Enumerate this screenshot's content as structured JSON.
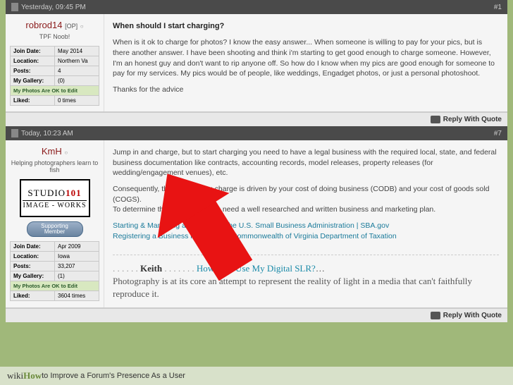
{
  "post1": {
    "timestamp": "Yesterday, 09:45 PM",
    "number": "#1",
    "user": {
      "name": "robrod14",
      "op_tag": "[OP]",
      "status_glyph": "○",
      "title": "TPF Noob!",
      "stats": {
        "join_label": "Join Date:",
        "join_value": "May 2014",
        "loc_label": "Location:",
        "loc_value": "Northern Va",
        "posts_label": "Posts:",
        "posts_value": "4",
        "gallery_label": "My Gallery:",
        "gallery_value": "(0)",
        "edit_ok": "My Photos Are OK to Edit",
        "liked_label": "Liked:",
        "liked_value": "0 times"
      }
    },
    "content": {
      "title": "When should I start charging?",
      "body1": "When is it ok to charge for photos? I know the easy answer... When someone is willing to pay for your pics, but is there another answer. I have been shooting and think i'm starting to get good enough to charge someone. However, I'm an honest guy and don't want to rip anyone off. So how do I know when my pics are good enough for someone to pay for my services. My pics would be of people, like weddings, Engadget photos, or just a personal photoshoot.",
      "body2": "Thanks for the advice"
    },
    "reply_label": "Reply With Quote"
  },
  "post2": {
    "timestamp": "Today, 10:23 AM",
    "number": "#7",
    "user": {
      "name": "KmH",
      "status_glyph": "○",
      "title": "Helping photographers learn to fish",
      "logo_top": "STUDIO",
      "logo_num": "101",
      "logo_bot": "IMAGE - WORKS",
      "support1": "Supporting",
      "support2": "Member",
      "stats": {
        "join_label": "Join Date:",
        "join_value": "Apr 2009",
        "loc_label": "Location:",
        "loc_value": "Iowa",
        "posts_label": "Posts:",
        "posts_value": "33,207",
        "gallery_label": "My Gallery:",
        "gallery_value": "(1)",
        "edit_ok": "My Photos Are OK to Edit",
        "liked_label": "Liked:",
        "liked_value": "3604 times"
      }
    },
    "content": {
      "body1": "Jump in and charge, but to start charging you need to have a legal business with the required local, state, and federal business documentation like contracts, accounting records, model releases, property releases (for wedding/engagement venues), etc.",
      "body2": "Consequently, the amount you charge is driven by your cost of doing business (CODB) and your cost of goods sold (COGS).",
      "body3": "To determine those numbers you need a well researched and written business and marketing plan.",
      "link1": "Starting & Managing a Business | The U.S. Small Business Administration | SBA.gov",
      "link2": "Registering a Business in Virginia -- Commonwealth of Virginia Department of Taxation",
      "sig_dots1": ". . . . . .",
      "sig_keith": "Keith",
      "sig_dots2": ". . . . . . .",
      "sig_link": "How Do I Use My Digital SLR?",
      "sig_link_trail": "…",
      "sig_body": "Photography is at its core an attempt to represent the reality of light in a media that can't faithfully reproduce it."
    },
    "reply_label": "Reply With Quote"
  },
  "caption": {
    "wiki": "wiki",
    "how": "How",
    "text": " to Improve a Forum's Presence As a User"
  }
}
